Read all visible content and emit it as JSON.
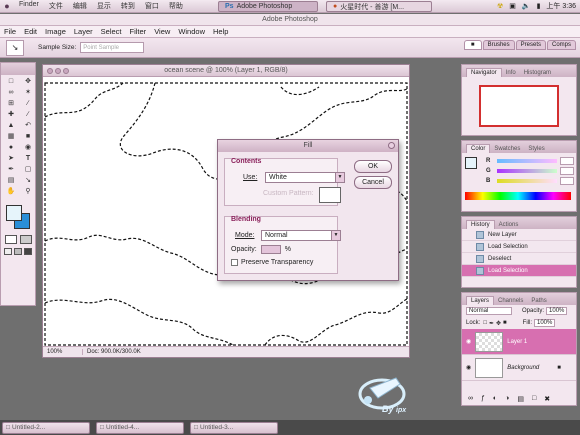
{
  "system_bar": {
    "menus": [
      "Finder",
      "文件",
      "编辑",
      "显示",
      "转到",
      "窗口",
      "帮助"
    ],
    "task_active": "Adobe Photoshop",
    "task_other": "火星时代 - 善游 [M...",
    "clock": "上午 3:36"
  },
  "app_title": "Adobe Photoshop",
  "menubar": [
    "File",
    "Edit",
    "Image",
    "Layer",
    "Select",
    "Filter",
    "View",
    "Window",
    "Help"
  ],
  "options_bar": {
    "sample_size_label": "Sample Size:",
    "sample_size_value": "Point Sample"
  },
  "dock_tabs": [
    "Brushes",
    "Presets",
    "Comps"
  ],
  "document": {
    "title": "ocean scene @ 100% (Layer 1, RGB/8)",
    "zoom": "100%",
    "doc_info": "Doc: 900.0K/300.0K"
  },
  "fill_dialog": {
    "title": "Fill",
    "contents_title": "Contents",
    "use_label": "Use:",
    "use_value": "White",
    "custom_pattern_label": "Custom Pattern:",
    "ok_label": "OK",
    "cancel_label": "Cancel",
    "blending_title": "Blending",
    "mode_label": "Mode:",
    "mode_value": "Normal",
    "opacity_label": "Opacity:",
    "opacity_unit": "%",
    "preserve_label": "Preserve Transparency"
  },
  "navigator_panel": {
    "tabs": [
      "Navigator",
      "Info",
      "Histogram"
    ]
  },
  "color_panel": {
    "tabs": [
      "Color",
      "Swatches",
      "Styles"
    ],
    "channels": [
      "R",
      "G",
      "B"
    ]
  },
  "history_panel": {
    "tabs": [
      "History",
      "Actions"
    ],
    "items": [
      "New Layer",
      "Load Selection",
      "Deselect",
      "Load Selection"
    ]
  },
  "layers_panel": {
    "tabs": [
      "Layers",
      "Channels",
      "Paths"
    ],
    "blend_mode": "Normal",
    "opacity_label": "Opacity:",
    "opacity_value": "100%",
    "lock_label": "Lock:",
    "fill_label": "Fill:",
    "fill_value": "100%",
    "layers": [
      "Layer 1",
      "Background"
    ]
  },
  "minimized_windows": [
    "Untitled-2...",
    "Untitled-4...",
    "Untitled-3..."
  ],
  "watermark": {
    "text": "By",
    "tail": "ipx"
  }
}
